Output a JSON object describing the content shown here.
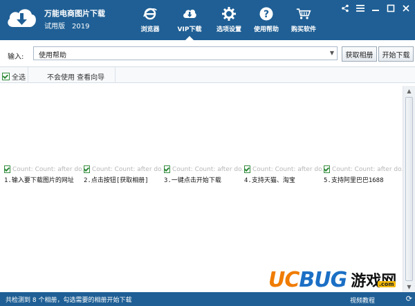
{
  "app": {
    "title": "万能电商图片下载",
    "edition": "试用版",
    "year": "2019"
  },
  "nav": [
    {
      "label": "浏览器",
      "icon": "browser-icon"
    },
    {
      "label": "VIP下载",
      "icon": "cloud-download-icon",
      "active": true
    },
    {
      "label": "选项设置",
      "icon": "gear-icon"
    },
    {
      "label": "使用帮助",
      "icon": "help-icon"
    },
    {
      "label": "购买软件",
      "icon": "cart-icon"
    }
  ],
  "window": {
    "share": "share-icon",
    "menu": "menu-icon",
    "minimize": "minimize-icon",
    "maximize": "maximize-icon",
    "close": "close-icon"
  },
  "input": {
    "label": "输入:",
    "value": "使用帮助",
    "get_album_label": "获取相册",
    "start_download_label": "开始下载"
  },
  "list_header": {
    "select_all": "全选",
    "guide": "不会使用 查看向导"
  },
  "items": [
    {
      "count_text": "Count: Count: after do...",
      "label": "1.输入要下载图片的网址",
      "checked": true
    },
    {
      "count_text": "Count: Count: after do...",
      "label": "2.点击按钮[获取相册]",
      "checked": true
    },
    {
      "count_text": "Count: Count: after do...",
      "label": "3.一键点击开始下载",
      "checked": true
    },
    {
      "count_text": "Count: Count: after do...",
      "label": "4.支持天猫、淘宝",
      "checked": true
    },
    {
      "count_text": "Count: Count: after do...",
      "label": "5.支持阿里巴巴1688",
      "checked": true
    }
  ],
  "status": {
    "text": "共检测到 8 个相册，勾选需要的相册开始下载",
    "tutorial": "视频教程",
    "refresh": "refresh-icon"
  },
  "watermark": {
    "brand": "UCBUG",
    "cn": "游戏网",
    "badge": ".com"
  },
  "colors": {
    "titlebar": "#1f5f95",
    "check": "#2f8a3a",
    "brand_orange": "#f07c00",
    "brand_blue": "#1b6fc5"
  }
}
